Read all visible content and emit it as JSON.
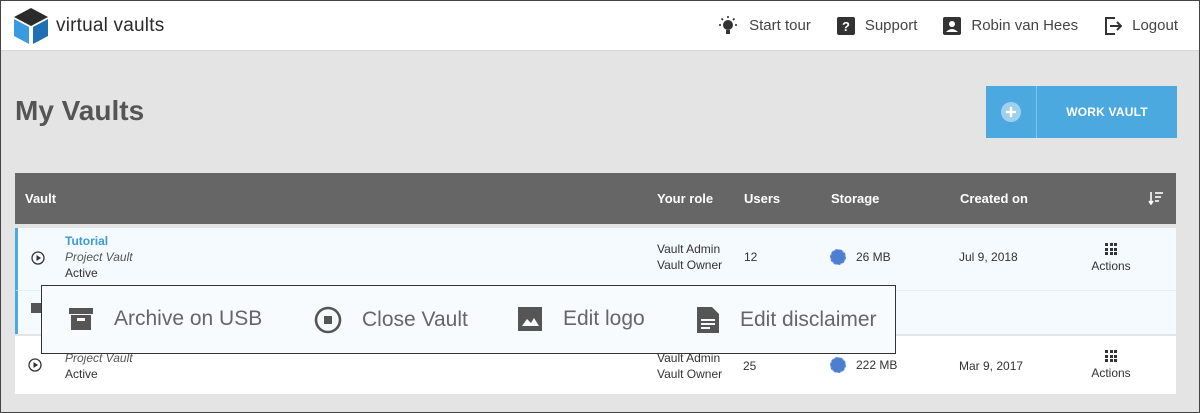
{
  "app": {
    "name": "virtual vaults"
  },
  "nav": {
    "start_tour": "Start tour",
    "support": "Support",
    "user": "Robin van Hees",
    "logout": "Logout"
  },
  "page": {
    "title": "My Vaults"
  },
  "cta": {
    "label": "WORK VAULT"
  },
  "table": {
    "columns": [
      "Vault",
      "Your role",
      "Users",
      "Storage",
      "Created on"
    ],
    "rows": [
      {
        "name": "Tutorial",
        "type": "Project Vault",
        "status": "Active",
        "role_1": "Vault Admin",
        "role_2": "Vault Owner",
        "users": "12",
        "storage": "26 MB",
        "created": "Jul 9, 2018",
        "actions": "Actions"
      },
      {
        "name": "",
        "type": "Project Vault",
        "status": "Active",
        "role_1": "Vault Admin",
        "role_2": "Vault Owner",
        "users": "25",
        "storage": "222 MB",
        "created": "Mar 9, 2017",
        "actions": "Actions"
      }
    ]
  },
  "overlay": {
    "archive": "Archive on USB",
    "close": "Close Vault",
    "edit_logo": "Edit logo",
    "edit_disclaimer": "Edit disclaimer"
  },
  "colors": {
    "accent": "#4ba9e0",
    "header_bg": "#666666",
    "page_bg": "#e4e4e4"
  }
}
